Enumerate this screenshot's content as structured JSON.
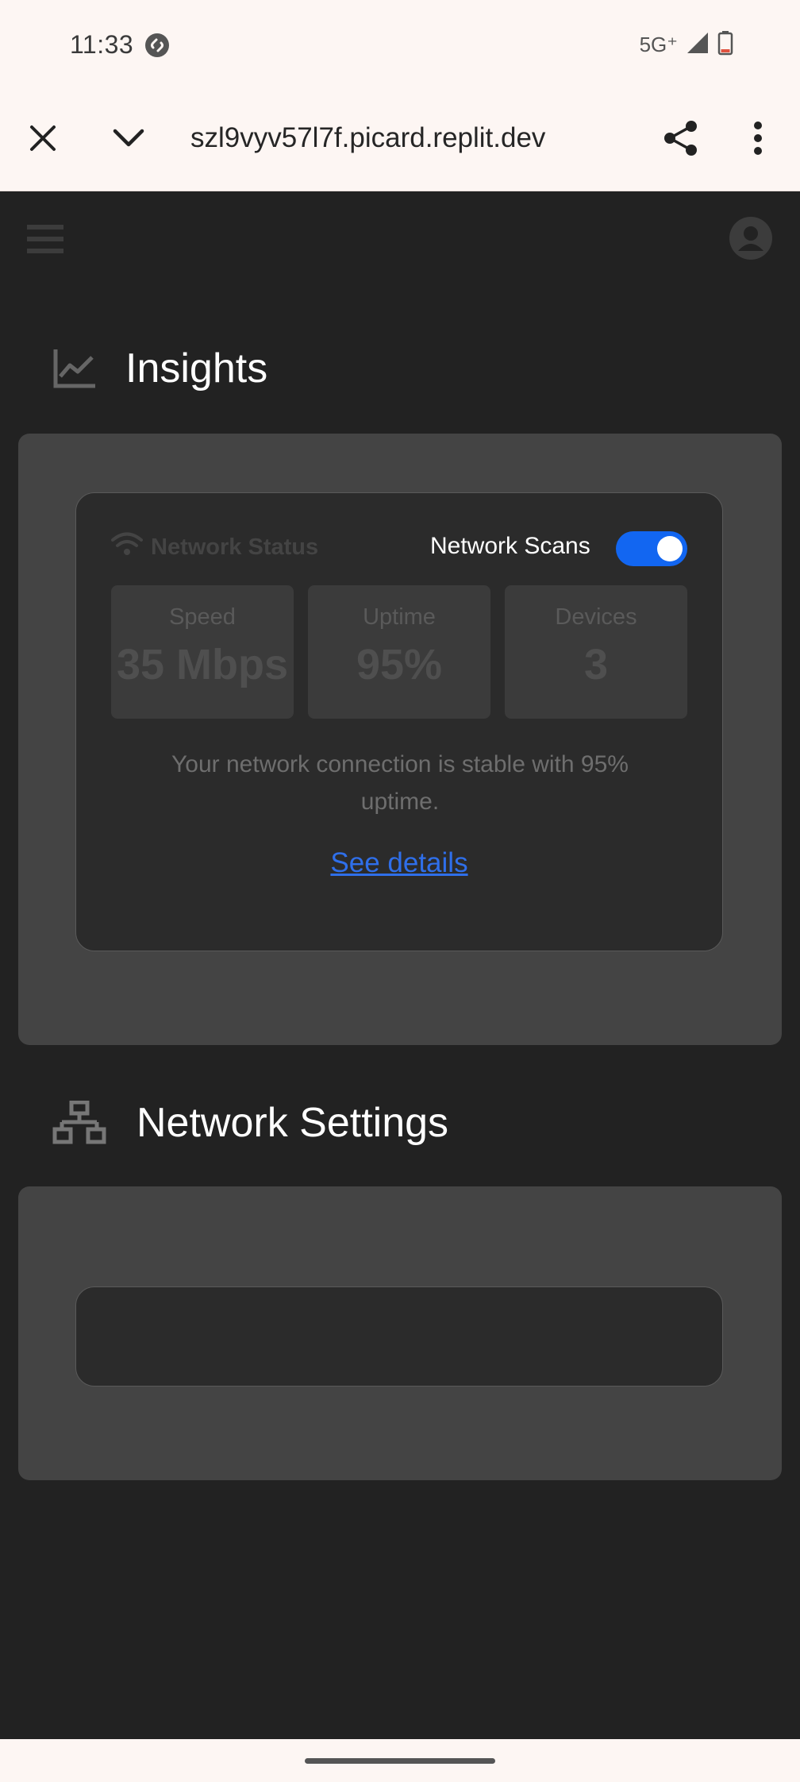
{
  "status_bar": {
    "time": "11:33",
    "network": "5G⁺",
    "icons": [
      "shazam-icon",
      "signal-icon",
      "battery-icon"
    ]
  },
  "browser": {
    "url": "szl9vyv57l7f.picard.replit.dev",
    "icons": [
      "close-icon",
      "chevron-down-icon",
      "share-icon",
      "more-vert-icon"
    ]
  },
  "app": {
    "icons": [
      "menu-icon",
      "account-icon"
    ]
  },
  "insights": {
    "title": "Insights",
    "icon": "chart-line-icon",
    "card": {
      "status_title": "Network Status",
      "status_icon": "wifi-icon",
      "scans_label": "Network Scans",
      "scans_enabled": true,
      "stats": [
        {
          "label": "Speed",
          "value": "35 Mbps"
        },
        {
          "label": "Uptime",
          "value": "95%"
        },
        {
          "label": "Devices",
          "value": "3"
        }
      ],
      "summary": "Your network connection is stable with 95% uptime.",
      "details_link": "See details"
    }
  },
  "network_settings": {
    "title": "Network Settings",
    "icon": "network-tree-icon"
  },
  "colors": {
    "accent": "#1266f1",
    "link": "#2f6fea",
    "background": "#222222",
    "panel": "#444444"
  }
}
